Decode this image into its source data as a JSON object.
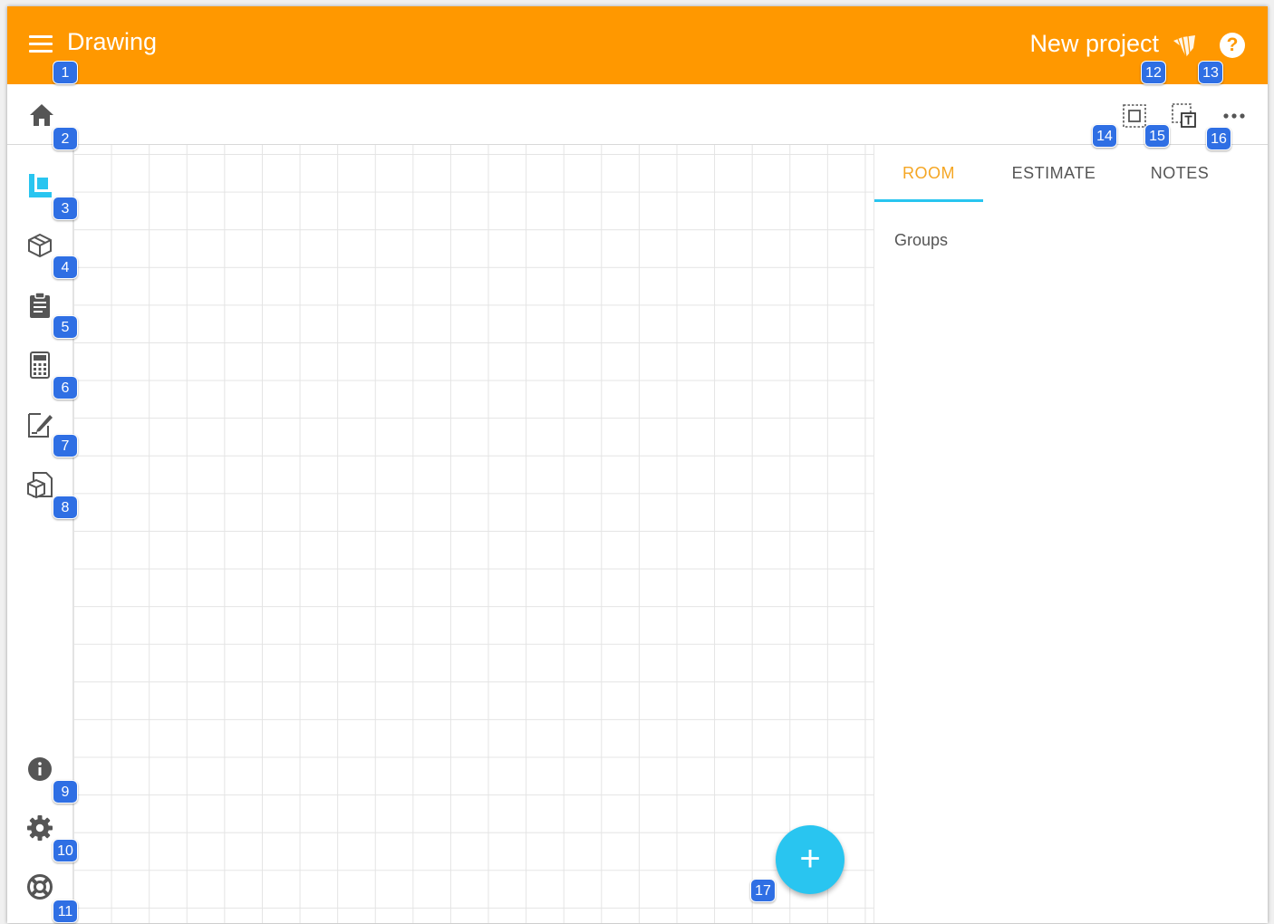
{
  "app_bar": {
    "title": "Drawing",
    "project_name": "New project",
    "help_label": "?",
    "color": "#FF9800"
  },
  "toolbar": {
    "icons": [
      "home-icon",
      "select-area-icon",
      "select-text-area-icon",
      "more-options-icon"
    ]
  },
  "sidebar": {
    "items": [
      {
        "icon": "floor-plan-icon",
        "active": true
      },
      {
        "icon": "3d-box-icon"
      },
      {
        "icon": "clipboard-icon"
      },
      {
        "icon": "calculator-icon"
      },
      {
        "icon": "edit-document-icon"
      },
      {
        "icon": "3d-document-icon"
      },
      {
        "icon": "info-icon"
      },
      {
        "icon": "settings-icon"
      },
      {
        "icon": "lifebuoy-icon"
      }
    ],
    "active_color": "#29C5F0"
  },
  "panel": {
    "tabs": [
      {
        "label": "ROOM",
        "active": true
      },
      {
        "label": "ESTIMATE"
      },
      {
        "label": "NOTES"
      }
    ],
    "groups_label": "Groups"
  },
  "fab": {
    "label": "+",
    "color": "#29C5F0"
  },
  "badges": [
    "1",
    "2",
    "3",
    "4",
    "5",
    "6",
    "7",
    "8",
    "9",
    "10",
    "11",
    "12",
    "13",
    "14",
    "15",
    "16",
    "17"
  ]
}
